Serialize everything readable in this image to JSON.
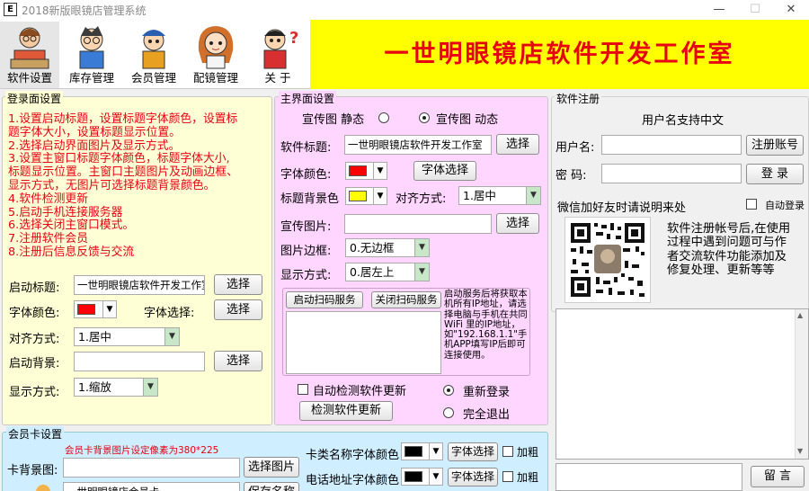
{
  "window": {
    "title": "2018新版眼镜店管理系统",
    "icon_letter": "E",
    "min": "—",
    "max": "☐",
    "close": "✕"
  },
  "toolbar": {
    "items": [
      {
        "label": "软件设置",
        "icon": "person-at-computer-icon"
      },
      {
        "label": "库存管理",
        "icon": "boy-with-glasses-icon"
      },
      {
        "label": "会员管理",
        "icon": "boy-with-cap-icon"
      },
      {
        "label": "配镜管理",
        "icon": "girl-cartoon-icon"
      },
      {
        "label": "关 于",
        "icon": "boy-with-question-icon"
      }
    ]
  },
  "banner": {
    "text": "一世明眼镜店软件开发工作室",
    "color": "#e60012",
    "bg": "#ffff00"
  },
  "login": {
    "group_title": "登录面设置",
    "instructions": [
      "1.设置启动标题，设置标题字体颜色，设置标",
      "题字体大小，设置标题显示位置。",
      "2.选择启动界面图片及显示方式。",
      "3.设置主窗口标题字体颜色，标题字体大小,",
      "标题显示位置。主窗口主题图片及动画边框、",
      "显示方式，无图片可选择标题背景颜色。",
      "4.软件检测更新",
      "5.启动手机连接服务器",
      "6.选择关闭主窗口模式。",
      "7.注册软件会员",
      "8.注册后信息反馈与交流"
    ],
    "title_label": "启动标题:",
    "title_value": "一世明眼镜店软件开发工作室",
    "select_btn": "选择",
    "font_color_label": "字体颜色:",
    "font_color": "#ff0000",
    "font_select_label": "字体选择:",
    "align_label": "对齐方式:",
    "align_value": "1.居中",
    "bg_label": "启动背景:",
    "display_label": "显示方式:",
    "display_value": "1.缩放"
  },
  "main": {
    "group_title": "主界面设置",
    "promo_static": "宣传图 静态",
    "promo_dynamic": "宣传图 动态",
    "title_label": "软件标题:",
    "title_value": "一世明眼镜店软件开发工作室",
    "select_btn": "选择",
    "font_color_label": "字体颜色:",
    "font_color": "#ff0000",
    "font_select_btn": "字体选择",
    "title_bg_label": "标题背景色",
    "title_bg_color": "#ffff00",
    "align_label": "对齐方式:",
    "align_value": "1.居中",
    "promo_pic_label": "宣传图片:",
    "border_label": "图片边框:",
    "border_value": "0.无边框",
    "display_label": "显示方式:",
    "display_value": "0.居左上",
    "start_scan_btn": "启动扫码服务",
    "stop_scan_btn": "关闭扫码服务",
    "scan_note": "启动服务后将获取本机所有IP地址，请选择电脑与手机在共同 WiFi 里的IP地址，如\"192.168.1.1\"手机APP填写IP后即可连接使用。",
    "auto_check_label": "自动检测软件更新",
    "check_btn": "检测软件更新",
    "relogin_label": "重新登录",
    "exit_label": "完全退出"
  },
  "register": {
    "group_title": "软件注册",
    "support_text": "用户名支持中文",
    "user_label": "用户名:",
    "register_btn": "注册账号",
    "pwd_label": "密  码:",
    "login_btn": "登 录",
    "wechat_text": "微信加好友时请说明来处",
    "auto_login_label": "自动登录",
    "desc": "软件注册帐号后,在使用过程中遇到问题可与作者交流软件功能添加及修复处理、更新等等",
    "comment_btn": "留 言"
  },
  "card": {
    "group_title": "会员卡设置",
    "hint": "会员卡背景图片设定像素为380*225",
    "bg_label": "卡背景图:",
    "select_pic_btn": "选择图片",
    "shop_value": "一世明眼镜店会员卡",
    "save_name_btn": "保存名称",
    "cat_font_label": "卡类名称字体颜色",
    "font_select_btn": "字体选择",
    "bold_label": "加粗",
    "phone_font_label": "电话地址字体颜色",
    "swatch_color": "#000000"
  }
}
